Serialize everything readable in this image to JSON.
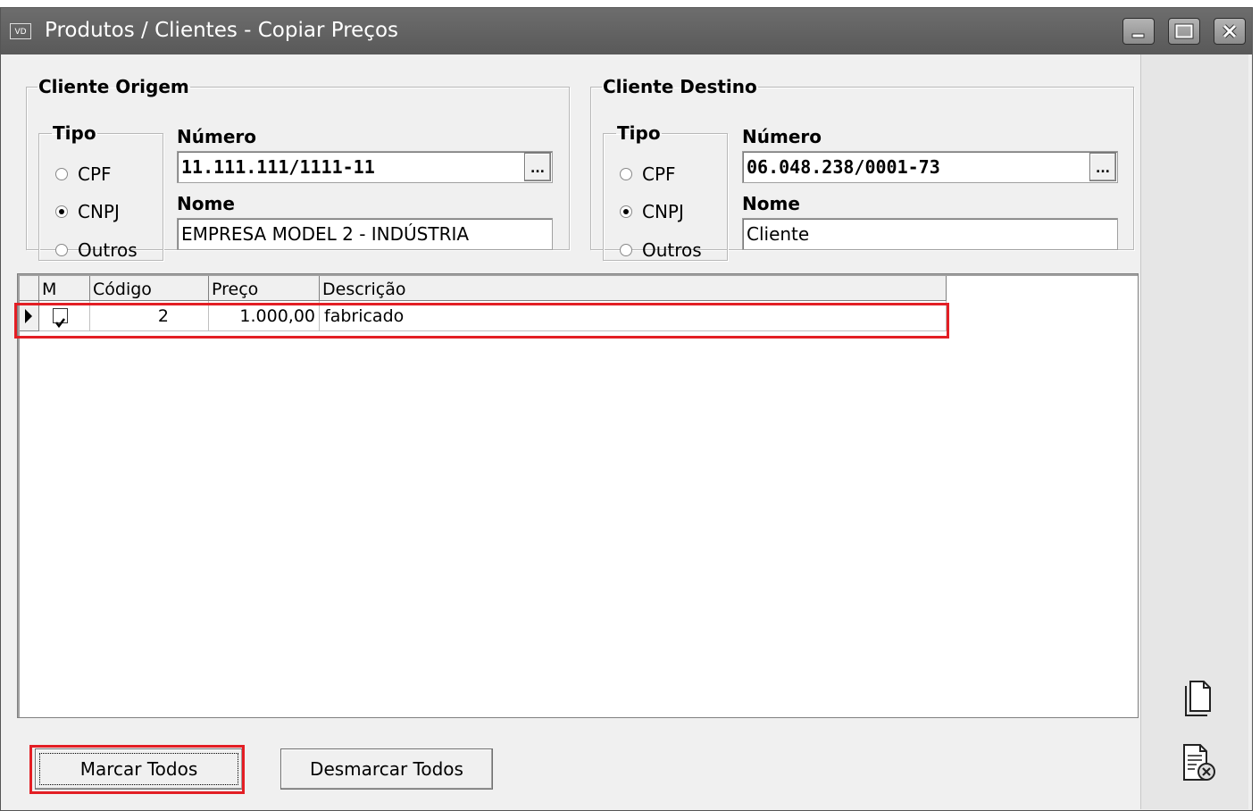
{
  "window": {
    "app_icon_text": "VD",
    "title": "Produtos / Clientes - Copiar Preços"
  },
  "origem": {
    "legend": "Cliente Origem",
    "tipo": {
      "legend": "Tipo",
      "options": [
        "CPF",
        "CNPJ",
        "Outros"
      ],
      "selected": "CNPJ"
    },
    "numero_label": "Número",
    "numero_value": "11.111.111/1111-11",
    "nome_label": "Nome",
    "nome_value": "EMPRESA MODEL 2 - INDÚSTRIA",
    "lookup_label": "..."
  },
  "destino": {
    "legend": "Cliente Destino",
    "tipo": {
      "legend": "Tipo",
      "options": [
        "CPF",
        "CNPJ",
        "Outros"
      ],
      "selected": "CNPJ"
    },
    "numero_label": "Número",
    "numero_value": "06.048.238/0001-73",
    "nome_label": "Nome",
    "nome_value": "Cliente",
    "lookup_label": "..."
  },
  "grid": {
    "columns": [
      "M",
      "Código",
      "Preço",
      "Descrição"
    ],
    "rows": [
      {
        "checked": true,
        "codigo": "2",
        "preco": "1.000,00",
        "descricao": "fabricado"
      }
    ]
  },
  "buttons": {
    "marcar_todos": "Marcar Todos",
    "desmarcar_todos": "Desmarcar Todos"
  },
  "side_icons": [
    "copy-document-icon",
    "cancel-document-icon"
  ],
  "colors": {
    "highlight": "#e31e24",
    "titlebar": "#616161"
  }
}
